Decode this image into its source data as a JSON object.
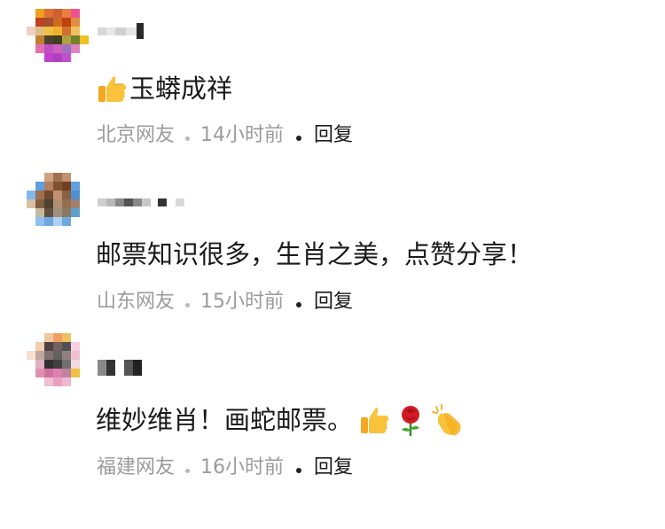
{
  "comments": [
    {
      "username": "",
      "text": "玉蟒成祥",
      "emoji_prefix": [
        "thumbs-up"
      ],
      "emoji_suffix": [],
      "location": "北京网友",
      "time": "14小时前",
      "reply_label": "回复"
    },
    {
      "username": "",
      "text": "邮票知识很多，生肖之美，点赞分享！",
      "emoji_prefix": [],
      "emoji_suffix": [],
      "location": "山东网友",
      "time": "15小时前",
      "reply_label": "回复"
    },
    {
      "username": "",
      "text": "维妙维肖！画蛇邮票。",
      "emoji_prefix": [],
      "emoji_suffix": [
        "thumbs-up",
        "rose",
        "clapping-hands"
      ],
      "location": "福建网友",
      "time": "16小时前",
      "reply_label": "回复"
    }
  ],
  "colors": {
    "meta_gray": "#9b9b9b",
    "text": "#1a1a1a",
    "background": "#ffffff"
  }
}
